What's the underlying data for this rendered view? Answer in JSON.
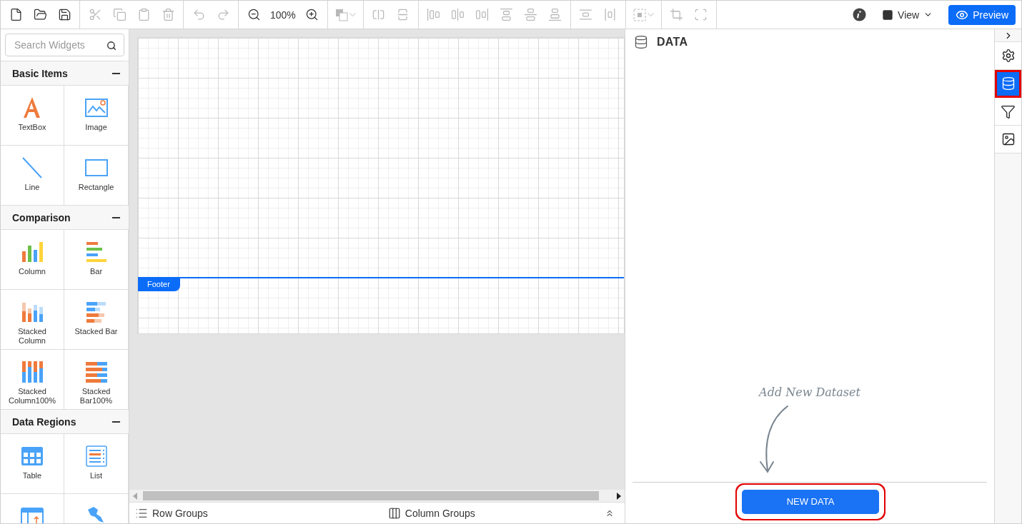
{
  "toolbar": {
    "groups": [
      {
        "buttons": [
          {
            "kind": "new",
            "disabled": false
          },
          {
            "kind": "open",
            "disabled": false
          },
          {
            "kind": "save",
            "disabled": false
          }
        ]
      },
      {
        "buttons": [
          {
            "kind": "cut",
            "disabled": true
          },
          {
            "kind": "copy",
            "disabled": true
          },
          {
            "kind": "paste",
            "disabled": true
          },
          {
            "kind": "delete",
            "disabled": true
          }
        ]
      },
      {
        "buttons": [
          {
            "kind": "undo",
            "disabled": true
          },
          {
            "kind": "redo",
            "disabled": true
          }
        ]
      },
      {
        "buttons": [
          {
            "kind": "zoom-out",
            "disabled": false
          },
          {
            "kind": "zoom-level",
            "label": "100%",
            "disabled": false
          },
          {
            "kind": "zoom-in",
            "disabled": false
          }
        ]
      },
      {
        "buttons": [
          {
            "kind": "layer-dropdown",
            "disabled": true
          }
        ]
      },
      {
        "buttons": [
          {
            "kind": "split-horizontal",
            "disabled": true
          },
          {
            "kind": "split-vertical",
            "disabled": true
          }
        ]
      },
      {
        "buttons": [
          {
            "kind": "align-left",
            "disabled": true
          },
          {
            "kind": "align-center",
            "disabled": true
          },
          {
            "kind": "align-right",
            "disabled": true
          },
          {
            "kind": "align-top",
            "disabled": true
          },
          {
            "kind": "align-middle",
            "disabled": true
          },
          {
            "kind": "align-bottom",
            "disabled": true
          }
        ]
      },
      {
        "buttons": [
          {
            "kind": "distribute-vertical",
            "disabled": true
          },
          {
            "kind": "distribute-horizontal",
            "disabled": true
          }
        ]
      },
      {
        "buttons": [
          {
            "kind": "select-dropdown",
            "disabled": true
          }
        ]
      },
      {
        "buttons": [
          {
            "kind": "crop",
            "disabled": true
          },
          {
            "kind": "center",
            "disabled": true
          }
        ]
      }
    ],
    "view": {
      "label": "View"
    },
    "preview": {
      "label": "Preview"
    }
  },
  "sidebar": {
    "search": {
      "placeholder": "Search Widgets"
    },
    "sections": [
      {
        "title": "Basic Items",
        "expanded": true,
        "widgets": [
          {
            "kind": "textbox",
            "label": "TextBox"
          },
          {
            "kind": "image",
            "label": "Image"
          },
          {
            "kind": "line",
            "label": "Line"
          },
          {
            "kind": "rectangle",
            "label": "Rectangle"
          }
        ]
      },
      {
        "title": "Comparison",
        "expanded": true,
        "widgets": [
          {
            "kind": "column",
            "label": "Column"
          },
          {
            "kind": "bar",
            "label": "Bar"
          },
          {
            "kind": "stacked-column",
            "label": "Stacked Column"
          },
          {
            "kind": "stacked-bar",
            "label": "Stacked Bar"
          },
          {
            "kind": "stacked-column100",
            "label": "Stacked Column100%"
          },
          {
            "kind": "stacked-bar100",
            "label": "Stacked Bar100%"
          }
        ]
      },
      {
        "title": "Data Regions",
        "expanded": true,
        "widgets": [
          {
            "kind": "table",
            "label": "Table"
          },
          {
            "kind": "list",
            "label": "List"
          },
          {
            "kind": "matrix"
          },
          {
            "kind": "map"
          }
        ]
      }
    ]
  },
  "canvas": {
    "footer_label": "Footer"
  },
  "bottom_bar": {
    "row_groups": "Row Groups",
    "column_groups": "Column Groups"
  },
  "data_panel": {
    "title": "DATA",
    "hint": "Add New Dataset",
    "button": {
      "label": "NEW DATA",
      "highlighted": true
    }
  },
  "rail": {
    "items": [
      {
        "kind": "settings",
        "selected": false,
        "highlighted": false
      },
      {
        "kind": "data",
        "selected": true,
        "highlighted": true
      },
      {
        "kind": "filter",
        "selected": false,
        "highlighted": false
      },
      {
        "kind": "image",
        "selected": false,
        "highlighted": false
      }
    ]
  }
}
